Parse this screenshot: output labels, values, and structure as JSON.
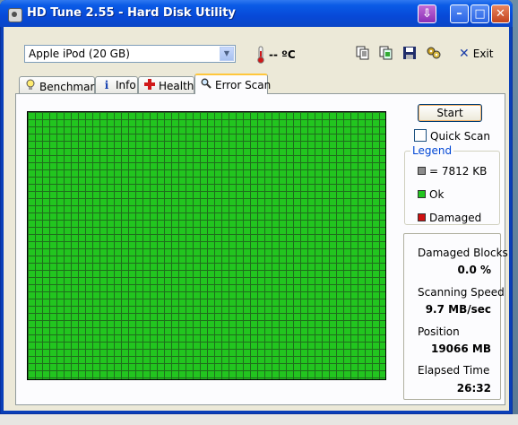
{
  "window": {
    "title": "HD Tune 2.55 - Hard Disk Utility"
  },
  "toolbar": {
    "drive": "Apple   iPod (20 GB)",
    "temperature": "-- ºC",
    "exit_label": "Exit",
    "icons": [
      "copy-text-icon",
      "copy-screenshot-icon",
      "save-icon",
      "options-icon"
    ]
  },
  "tabs": [
    {
      "label": "Benchmark",
      "icon": "lightbulb-icon"
    },
    {
      "label": "Info",
      "icon": "info-icon"
    },
    {
      "label": "Health",
      "icon": "health-cross-icon"
    },
    {
      "label": "Error Scan",
      "icon": "magnifier-icon"
    }
  ],
  "active_tab": "Error Scan",
  "controls": {
    "start_label": "Start",
    "quick_scan_label": "Quick Scan",
    "quick_scan_checked": false
  },
  "legend": {
    "title": "Legend",
    "items": [
      {
        "label": "= 7812 KB",
        "color": "#8c8c8c"
      },
      {
        "label": "Ok",
        "color": "#22c51f"
      },
      {
        "label": "Damaged",
        "color": "#d01010"
      }
    ]
  },
  "stats": {
    "damaged_blocks": {
      "label": "Damaged Blocks",
      "value": "0.0 %"
    },
    "scanning_speed": {
      "label": "Scanning Speed",
      "value": "9.7 MB/sec"
    },
    "position": {
      "label": "Position",
      "value": "19066 MB"
    },
    "elapsed_time": {
      "label": "Elapsed Time",
      "value": "26:32"
    }
  },
  "scan_grid": {
    "status": "ok",
    "color": "#22c51f",
    "damaged_percent": 0.0
  }
}
